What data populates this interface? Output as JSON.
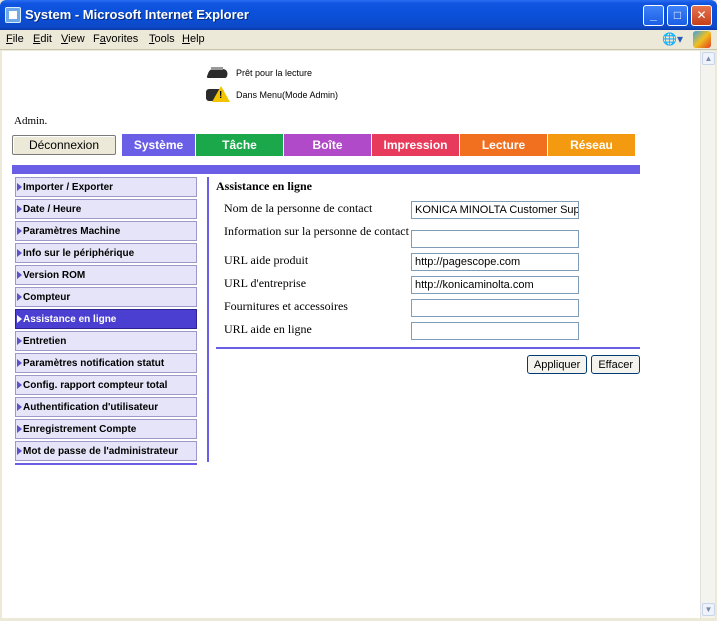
{
  "window": {
    "title": "System - Microsoft Internet Explorer",
    "controls": [
      "minimize-icon",
      "maximize-icon",
      "close-icon"
    ]
  },
  "menubar": {
    "items": [
      {
        "label": "File",
        "underline": "F"
      },
      {
        "label": "Edit",
        "underline": "E"
      },
      {
        "label": "View",
        "underline": "V"
      },
      {
        "label": "Favorites",
        "underline": "a"
      },
      {
        "label": "Tools",
        "underline": "T"
      },
      {
        "label": "Help",
        "underline": "H"
      }
    ]
  },
  "status": {
    "line1": "Prêt pour la lecture",
    "line2": "Dans Menu(Mode Admin)"
  },
  "admin_label": "Admin.",
  "tabs": [
    {
      "label": "Déconnexion",
      "color": "#ece9d8"
    },
    {
      "label": "Système",
      "color": "#6a5ee6"
    },
    {
      "label": "Tâche",
      "color": "#1aa84a"
    },
    {
      "label": "Boîte",
      "color": "#b04ac8"
    },
    {
      "label": "Impression",
      "color": "#e83a5a"
    },
    {
      "label": "Lecture",
      "color": "#f07020"
    },
    {
      "label": "Réseau",
      "color": "#f49a10"
    }
  ],
  "sidebar": {
    "items": [
      {
        "label": "Importer / Exporter",
        "active": false
      },
      {
        "label": "Date / Heure",
        "active": false
      },
      {
        "label": "Paramètres Machine",
        "active": false
      },
      {
        "label": "Info sur le périphérique",
        "active": false
      },
      {
        "label": "Version ROM",
        "active": false
      },
      {
        "label": "Compteur",
        "active": false
      },
      {
        "label": "Assistance en ligne",
        "active": true
      },
      {
        "label": "Entretien",
        "active": false
      },
      {
        "label": "Paramètres notification statut",
        "active": false
      },
      {
        "label": "Config. rapport compteur total",
        "active": false
      },
      {
        "label": "Authentification d'utilisateur",
        "active": false
      },
      {
        "label": "Enregistrement Compte",
        "active": false
      },
      {
        "label": "Mot de passe de l'administrateur",
        "active": false
      }
    ]
  },
  "form": {
    "title": "Assistance en ligne",
    "fields": [
      {
        "label": "Nom de la personne de contact",
        "value": "KONICA MINOLTA Customer Supp"
      },
      {
        "label": "Information sur la personne de contact",
        "value": ""
      },
      {
        "label": "URL aide produit",
        "value": "http://pagescope.com"
      },
      {
        "label": "URL d'entreprise",
        "value": "http://konicaminolta.com"
      },
      {
        "label": "Fournitures et accessoires",
        "value": ""
      },
      {
        "label": "URL aide en ligne",
        "value": ""
      }
    ],
    "apply_label": "Appliquer",
    "clear_label": "Effacer"
  }
}
